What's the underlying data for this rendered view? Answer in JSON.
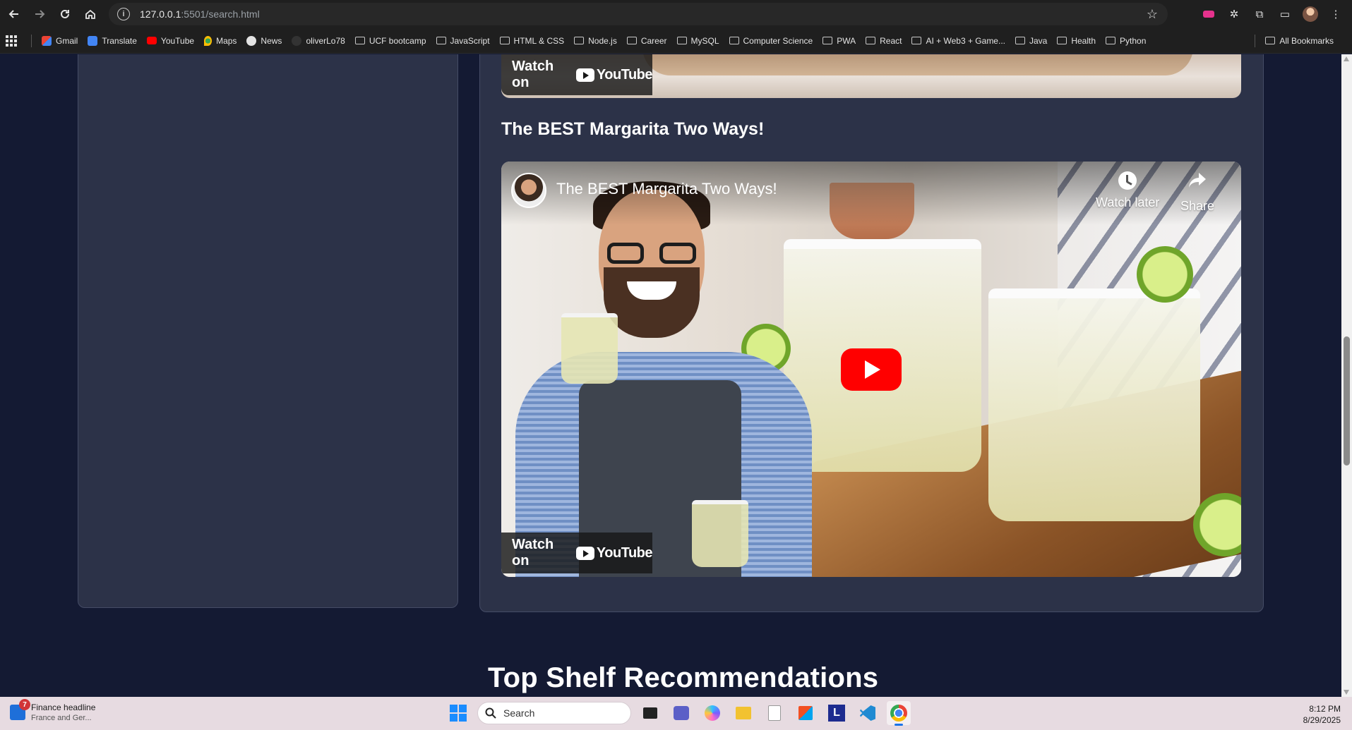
{
  "browser": {
    "url_host": "127.0.0.1",
    "url_path": ":5501/search.html"
  },
  "bookmarks": {
    "items": [
      {
        "label": "Gmail",
        "icon": "gmail-icon",
        "type": "site"
      },
      {
        "label": "Translate",
        "icon": "translate-icon",
        "type": "site"
      },
      {
        "label": "YouTube",
        "icon": "youtube-icon",
        "type": "site"
      },
      {
        "label": "Maps",
        "icon": "maps-icon",
        "type": "site"
      },
      {
        "label": "News",
        "icon": "news-icon",
        "type": "site"
      },
      {
        "label": "oliverLo78",
        "icon": "github-icon",
        "type": "site"
      },
      {
        "label": "UCF bootcamp",
        "type": "folder"
      },
      {
        "label": "JavaScript",
        "type": "folder"
      },
      {
        "label": "HTML & CSS",
        "type": "folder"
      },
      {
        "label": "Node.js",
        "type": "folder"
      },
      {
        "label": "Career",
        "type": "folder"
      },
      {
        "label": "MySQL",
        "type": "folder"
      },
      {
        "label": "Computer Science",
        "type": "folder"
      },
      {
        "label": "PWA",
        "type": "folder"
      },
      {
        "label": "React",
        "type": "folder"
      },
      {
        "label": "AI + Web3 + Game...",
        "type": "folder"
      },
      {
        "label": "Java",
        "type": "folder"
      },
      {
        "label": "Health",
        "type": "folder"
      },
      {
        "label": "Python",
        "type": "folder"
      }
    ],
    "all_bookmarks": "All Bookmarks"
  },
  "content": {
    "watch_on": "Watch on",
    "youtube_word": "YouTube",
    "video_title": "The BEST Margarita Two Ways!",
    "player_title": "The BEST Margarita Two Ways!",
    "watch_later": "Watch later",
    "share": "Share",
    "section_heading": "Top Shelf Recommendations"
  },
  "taskbar": {
    "news_badge": "7",
    "news_title": "Finance headline",
    "news_sub": "France and Ger...",
    "search_label": "Search",
    "time": "8:12 PM",
    "date": "8/29/2025"
  },
  "colors": {
    "page_bg": "#141a33",
    "card_bg": "#2c3248",
    "youtube_red": "#ff0000"
  }
}
